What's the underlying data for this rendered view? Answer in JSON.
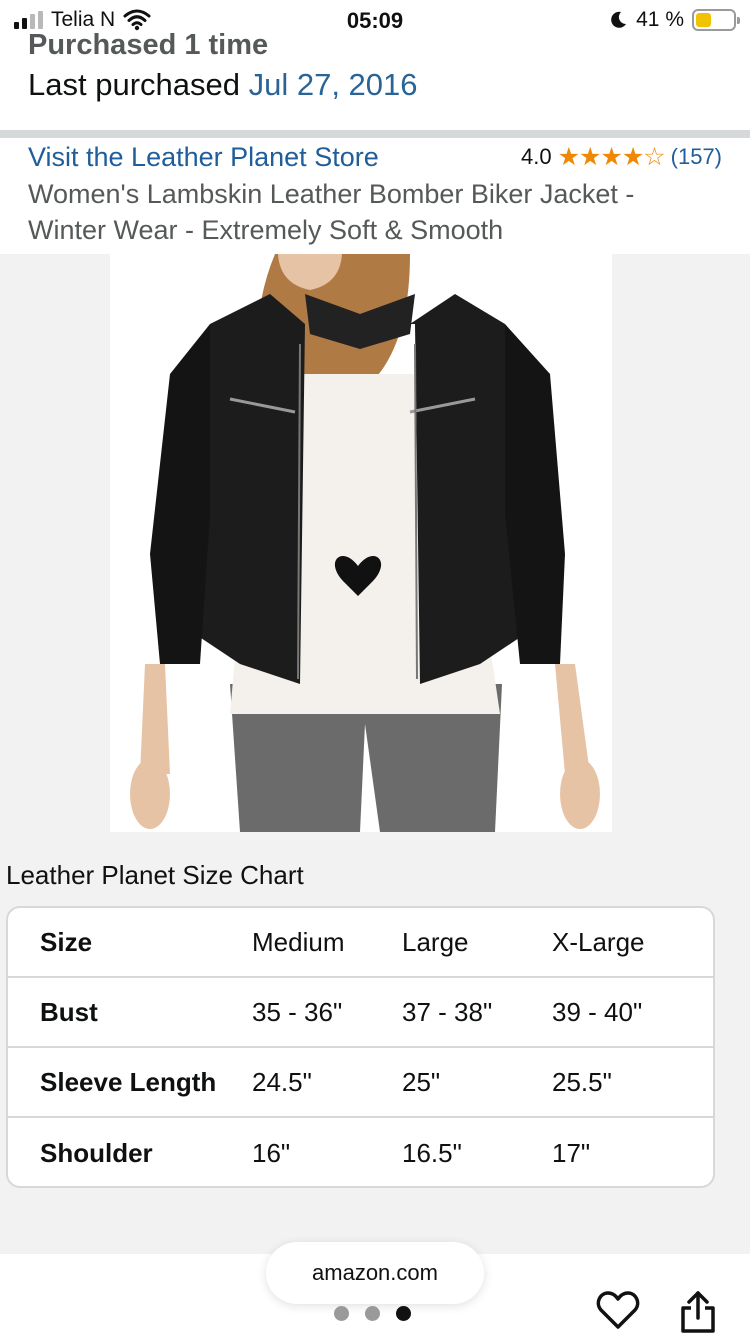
{
  "status_bar": {
    "carrier": "Telia N",
    "time": "05:09",
    "battery_percent": "41 %",
    "battery_level": 0.41,
    "icons": [
      "signal-icon",
      "wifi-icon",
      "moon-icon",
      "battery-icon"
    ]
  },
  "purchase": {
    "count_text": "Purchased 1 time",
    "last_label": "Last purchased",
    "last_date": "Jul 27, 2016"
  },
  "product": {
    "store_link": "Visit the Leather Planet Store",
    "rating_value": "4.0",
    "rating_stars": "★★★★☆",
    "rating_count": "(157)",
    "title": "Women's Lambskin Leather Bomber Biker Jacket - Winter Wear - Extremely Soft & Smooth"
  },
  "size_chart": {
    "title": "Leather Planet Size Chart",
    "rows": [
      [
        "Size",
        "Medium",
        "Large",
        "X-Large"
      ],
      [
        "Bust",
        "35 - 36\"",
        "37 - 38\"",
        "39 - 40\""
      ],
      [
        "Sleeve Length",
        "24.5\"",
        "25\"",
        "25.5\""
      ],
      [
        "Shoulder",
        "16\"",
        "16.5\"",
        "17\""
      ]
    ]
  },
  "bottom": {
    "url": "amazon.com",
    "pages": 3,
    "active_page": 3
  },
  "colors": {
    "link": "#1f5e9a",
    "star": "#f08804",
    "battery": "#f2c200"
  }
}
